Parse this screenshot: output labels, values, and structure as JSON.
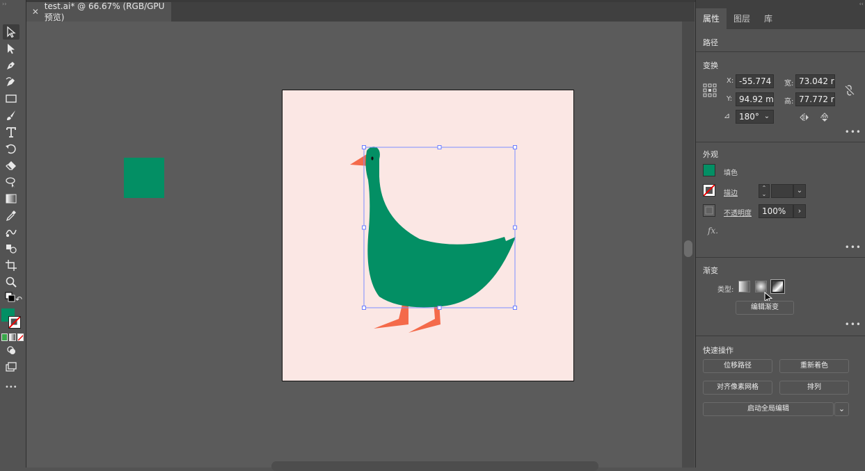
{
  "document": {
    "tab_title": "test.ai* @ 66.67% (RGB/GPU 预览)",
    "close_glyph": "✕"
  },
  "colors": {
    "fill": "#038f64",
    "accent_orange": "#f46a4a",
    "artboard_bg": "#fbe7e4",
    "selection": "#7b8cff"
  },
  "toolbar": {
    "tools": [
      "selection-tool",
      "direct-selection-tool",
      "pen-tool",
      "curvature-tool",
      "rectangle-tool",
      "paintbrush-tool",
      "type-tool",
      "rotate-tool",
      "eraser-tool",
      "warp-tool",
      "gradient-tool",
      "eyedropper-tool",
      "blend-tool",
      "shape-builder-tool",
      "artboard-tool",
      "zoom-tool"
    ],
    "more_label": "•••"
  },
  "panel": {
    "tabs": [
      "属性",
      "图层",
      "库"
    ],
    "object_type": "路径",
    "transform": {
      "title": "变换",
      "x_label": "X:",
      "x_value": "-55.774",
      "y_label": "Y:",
      "y_value": "94.92 m",
      "w_label": "宽:",
      "w_value": "73.042 r",
      "h_label": "高:",
      "h_value": "77.772 r",
      "angle_value": "180°"
    },
    "appearance": {
      "title": "外观",
      "fill_label": "填色",
      "stroke_label": "描边",
      "opacity_label": "不透明度",
      "opacity_value": "100%",
      "fx_label": "fx."
    },
    "gradient": {
      "title": "渐变",
      "type_label": "类型:",
      "edit_button": "编辑渐变"
    },
    "quick_actions": {
      "title": "快速操作",
      "offset_path": "位移路径",
      "recolor": "重新着色",
      "align_pixel_grid": "对齐像素网格",
      "arrange": "排列",
      "global_edit": "启动全局编辑"
    },
    "more_label": "•••"
  }
}
